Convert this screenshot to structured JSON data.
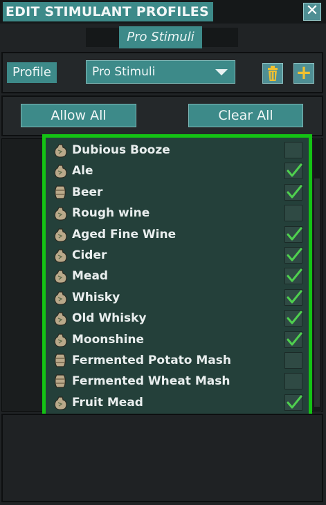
{
  "window": {
    "title": "EDIT STIMULANT PROFILES",
    "subtitle": "Pro Stimuli",
    "close_glyph": "✕"
  },
  "profile": {
    "label": "Profile",
    "selected": "Pro Stimuli",
    "delete_icon": "trash-icon",
    "add_glyph": "+"
  },
  "actions": {
    "allow_all": "Allow All",
    "clear_all": "Clear All"
  },
  "colors": {
    "accent": "#3d8a89",
    "highlight_border": "#14c214",
    "check": "#4fd04f",
    "plus": "#f0c030"
  },
  "items": [
    {
      "name": "Dubious Booze",
      "icon": "booze-sack-icon",
      "checked": false
    },
    {
      "name": "Ale",
      "icon": "ale-sack-icon",
      "checked": true
    },
    {
      "name": "Beer",
      "icon": "beer-barrel-icon",
      "checked": true
    },
    {
      "name": "Rough wine",
      "icon": "wine-sack-icon",
      "checked": false
    },
    {
      "name": "Aged Fine Wine",
      "icon": "wine-sack-icon",
      "checked": true
    },
    {
      "name": "Cider",
      "icon": "cider-sack-icon",
      "checked": true
    },
    {
      "name": "Mead",
      "icon": "mead-sack-icon",
      "checked": true
    },
    {
      "name": "Whisky",
      "icon": "whisky-sack-icon",
      "checked": true
    },
    {
      "name": "Old Whisky",
      "icon": "whisky-sack-icon",
      "checked": true
    },
    {
      "name": "Moonshine",
      "icon": "moonshine-sack-icon",
      "checked": true
    },
    {
      "name": "Fermented Potato Mash",
      "icon": "mash-barrel-icon",
      "checked": false
    },
    {
      "name": "Fermented Wheat Mash",
      "icon": "mash-barrel-icon",
      "checked": false
    },
    {
      "name": "Fruit Mead",
      "icon": "mead-sack-icon",
      "checked": true
    }
  ]
}
